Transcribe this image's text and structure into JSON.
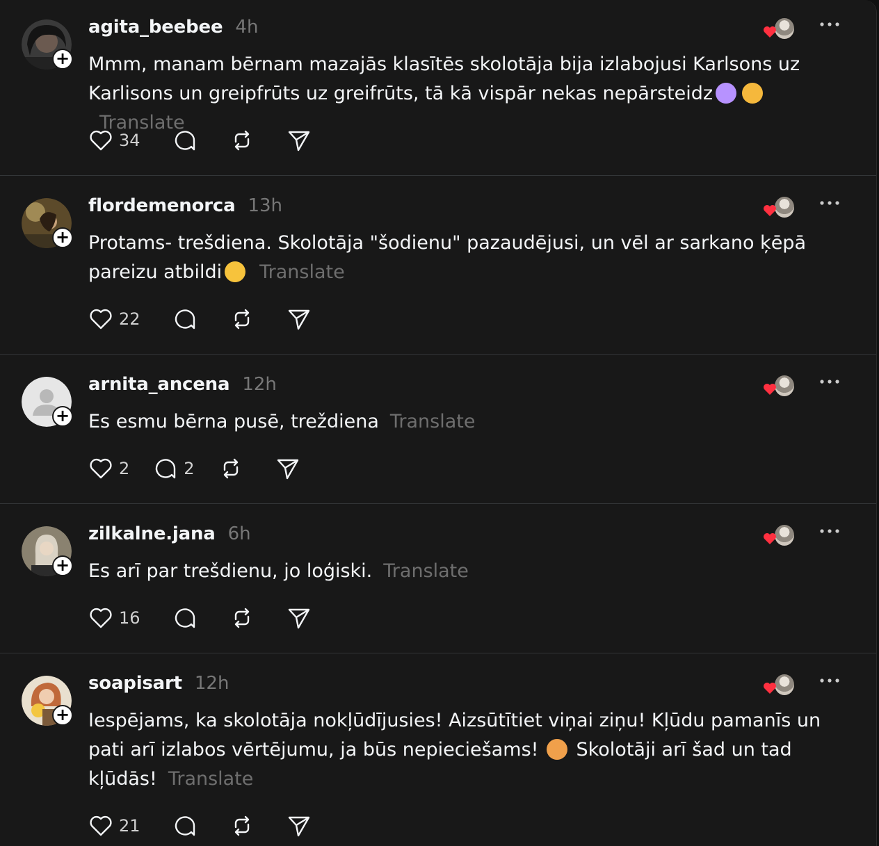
{
  "posts": [
    {
      "username": "agita_beebee",
      "time": "4h",
      "text": "Mmm, manam bērnam mazajās klasītēs skolotāja bija izlabojusi Karlsons uz Karlisons un greipfrūts uz greifrūts, tā kā vispār nekas nepārsteidz",
      "translate": "Translate",
      "likes": "34",
      "replies": ""
    },
    {
      "username": "flordemenorca",
      "time": "13h",
      "text": "Protams- trešdiena. Skolotāja \"šodienu\" pazaudējusi, un vēl ar sarkano ķēpā pareizu atbildi",
      "translate": "Translate",
      "likes": "22",
      "replies": ""
    },
    {
      "username": "arnita_ancena",
      "time": "12h",
      "text": "Es esmu bērna pusē, treždiena",
      "translate": "Translate",
      "likes": "2",
      "replies": "2"
    },
    {
      "username": "zilkalne.jana",
      "time": "6h",
      "text": "Es arī par trešdienu, jo loģiski.",
      "translate": "Translate",
      "likes": "16",
      "replies": ""
    },
    {
      "username": "soapisart",
      "time": "12h",
      "text": "Iespējams, ka skolotāja nokļūdījusies! Aizsūtītiet viņai ziņu! Kļūdu pamanīs un pati arī izlabos vērtējumu, ja būs nepieciešams!",
      "text2": "Skolotāji arī šad un tad kļūdās!",
      "translate": "Translate",
      "likes": "21",
      "replies": ""
    }
  ],
  "icons": {
    "like": "heart-icon",
    "reply": "comment-icon",
    "repost": "repost-icon",
    "share": "send-icon",
    "more": "more-icon",
    "follow": "plus-icon"
  },
  "colors": {
    "background": "#181818",
    "text": "#f3f5f7",
    "muted": "#777777",
    "heart": "#ff3040",
    "divider": "#333638"
  }
}
